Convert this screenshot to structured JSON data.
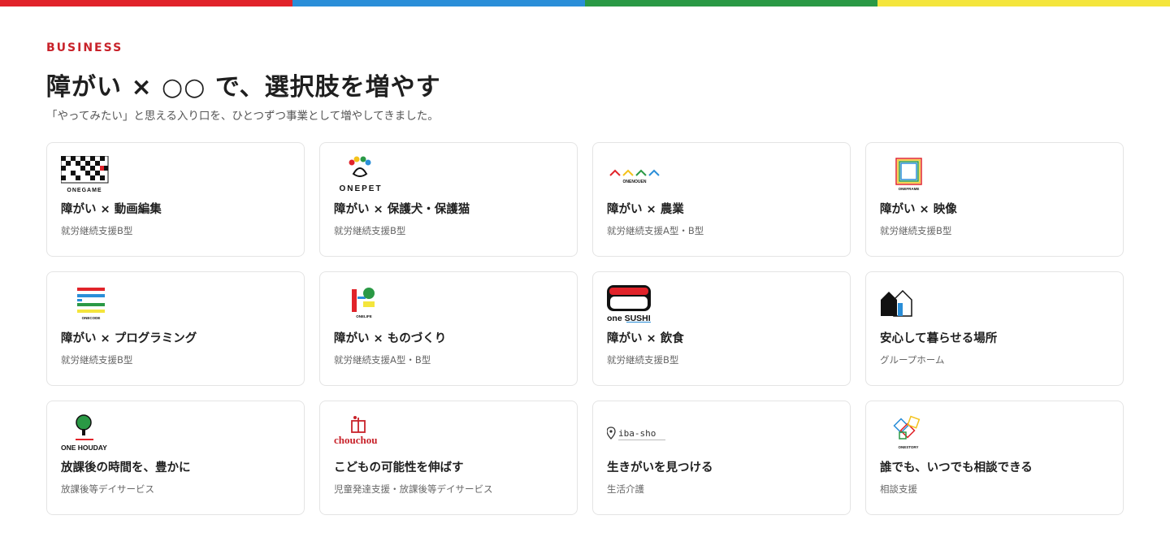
{
  "colors": {
    "bar": [
      "#e1232a",
      "#2a8ed8",
      "#2a9945",
      "#f4e53c"
    ],
    "accent": "#c8222a"
  },
  "section": {
    "eyebrow": "BUSINESS",
    "title": "障がい × ○○ で、選択肢を増やす",
    "subtitle": "「やってみたい」と思える入り口を、ひとつずつ事業として増やしてきました。"
  },
  "cards": [
    {
      "logo_text": "ONEGAME",
      "logo_icon": "onegame-logo",
      "title": "障がい × 動画編集",
      "sub": "就労継続支援B型"
    },
    {
      "logo_text": "ONEPET",
      "logo_icon": "onepet-paw-logo",
      "title": "障がい × 保護犬・保護猫",
      "sub": "就労継続支援B型"
    },
    {
      "logo_text": "ONENOUEN",
      "logo_icon": "onenouen-logo",
      "title": "障がい × 農業",
      "sub": "就労継続支援A型・B型"
    },
    {
      "logo_text": "ONEFRAME",
      "logo_icon": "oneframe-logo",
      "title": "障がい × 映像",
      "sub": "就労継続支援B型"
    },
    {
      "logo_text": "ONECODE",
      "logo_icon": "onecode-logo",
      "title": "障がい × プログラミング",
      "sub": "就労継続支援B型"
    },
    {
      "logo_text": "ONELIFE",
      "logo_icon": "onelife-logo",
      "title": "障がい × ものづくり",
      "sub": "就労継続支援A型・B型"
    },
    {
      "logo_text": "one SUSHI",
      "logo_icon": "onesushi-logo",
      "title": "障がい × 飲食",
      "sub": "就労継続支援B型"
    },
    {
      "logo_text": "",
      "logo_icon": "house-logo",
      "title": "安心して暮らせる場所",
      "sub": "グループホーム"
    },
    {
      "logo_text": "ONE HOUDAY",
      "logo_icon": "onehouday-tree-logo",
      "title": "放課後の時間を、豊かに",
      "sub": "放課後等デイサービス"
    },
    {
      "logo_text": "chouchou",
      "logo_icon": "chouchou-logo",
      "title": "こどもの可能性を伸ばす",
      "sub": "児童発達支援・放課後等デイサービス"
    },
    {
      "logo_text": "iba-sho",
      "logo_icon": "ibasho-pin-logo",
      "title": "生きがいを見つける",
      "sub": "生活介護"
    },
    {
      "logo_text": "ONESTORY",
      "logo_icon": "onestory-logo",
      "title": "誰でも、いつでも相談できる",
      "sub": "相談支援"
    }
  ]
}
